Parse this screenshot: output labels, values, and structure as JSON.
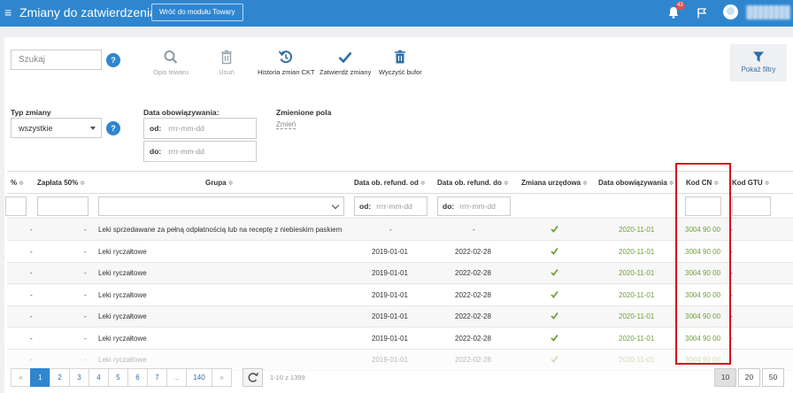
{
  "header": {
    "title": "Zmiany do zatwierdzenia",
    "back_button": "Wróć do modułu Towary",
    "notification_count": "43"
  },
  "toolbar": {
    "search_placeholder": "Szukaj",
    "help": "?",
    "actions": [
      {
        "label": "Opis towaru",
        "icon": "search-icon",
        "enabled": false
      },
      {
        "label": "Usuń",
        "icon": "trash-icon",
        "enabled": false
      },
      {
        "label": "Historia zmian CKT",
        "icon": "history-icon",
        "enabled": true
      },
      {
        "label": "Zatwierdź zmiany",
        "icon": "check-icon",
        "enabled": true
      },
      {
        "label": "Wyczyść bufor",
        "icon": "trash-icon",
        "enabled": true
      }
    ],
    "filter_button": "Pokaż filtry"
  },
  "filters": {
    "typ_zmiany_label": "Typ zmiany",
    "typ_zmiany_value": "wszystkie",
    "data_label": "Data obowiązywania:",
    "od_label": "od:",
    "do_label": "do:",
    "date_placeholder": "rrrr-mm-dd",
    "zmienione_pola_label": "Zmienione pola",
    "zmien_link": "Zmień"
  },
  "table": {
    "columns": [
      "%",
      "Zapłata 50%",
      "Grupa",
      "Data ob. refund. od",
      "Data ob. refund. do",
      "Zmiana urzędowa",
      "Data obowiązywania",
      "Kod CN",
      "Kod GTU"
    ],
    "sort_glyph": "≑",
    "filter_od": "od:",
    "filter_do": "do:",
    "filter_placeholder": "rrrr-mm-dd",
    "rows": [
      {
        "pct": "-",
        "zaplata": "-",
        "grupa": "Leki sprzedawane za pełną odpłatnością lub na receptę z niebieskim paskiem",
        "od": "-",
        "do": "-",
        "urzedowa": true,
        "data": "2020-11-01",
        "cn": "3004 90 00",
        "gtu": "-"
      },
      {
        "pct": "-",
        "zaplata": "-",
        "grupa": "Leki ryczałtowe",
        "od": "2019-01-01",
        "do": "2022-02-28",
        "urzedowa": true,
        "data": "2020-11-01",
        "cn": "3004 90 00",
        "gtu": "-"
      },
      {
        "pct": "-",
        "zaplata": "-",
        "grupa": "Leki ryczałtowe",
        "od": "2019-01-01",
        "do": "2022-02-28",
        "urzedowa": true,
        "data": "2020-11-01",
        "cn": "3004 90 00",
        "gtu": "-"
      },
      {
        "pct": "-",
        "zaplata": "-",
        "grupa": "Leki ryczałtowe",
        "od": "2019-01-01",
        "do": "2022-02-28",
        "urzedowa": true,
        "data": "2020-11-01",
        "cn": "3004 90 00",
        "gtu": "-"
      },
      {
        "pct": "-",
        "zaplata": "-",
        "grupa": "Leki ryczałtowe",
        "od": "2019-01-01",
        "do": "2022-02-28",
        "urzedowa": true,
        "data": "2020-11-01",
        "cn": "3004 90 00",
        "gtu": "-"
      },
      {
        "pct": "-",
        "zaplata": "-",
        "grupa": "Leki ryczałtowe",
        "od": "2019-01-01",
        "do": "2022-02-28",
        "urzedowa": true,
        "data": "2020-11-01",
        "cn": "3004 90 00",
        "gtu": "-"
      },
      {
        "pct": "-",
        "zaplata": "-",
        "grupa": "Leki ryczałtowe",
        "od": "2019-01-01",
        "do": "2022-02-28",
        "urzedowa": true,
        "data": "2020-11-01",
        "cn": "3004 90 00",
        "gtu": "-"
      }
    ]
  },
  "pagination": {
    "prev": "«",
    "pages": [
      "1",
      "2",
      "3",
      "4",
      "5",
      "6",
      "7",
      "...",
      "140"
    ],
    "next": "»",
    "active_page": "1",
    "summary": "1-10 z 1399",
    "page_sizes": [
      "10",
      "20",
      "50"
    ],
    "active_size": "10"
  },
  "colors": {
    "primary": "#2f86cf",
    "green": "#6ea03a",
    "highlight": "#d0161d"
  }
}
